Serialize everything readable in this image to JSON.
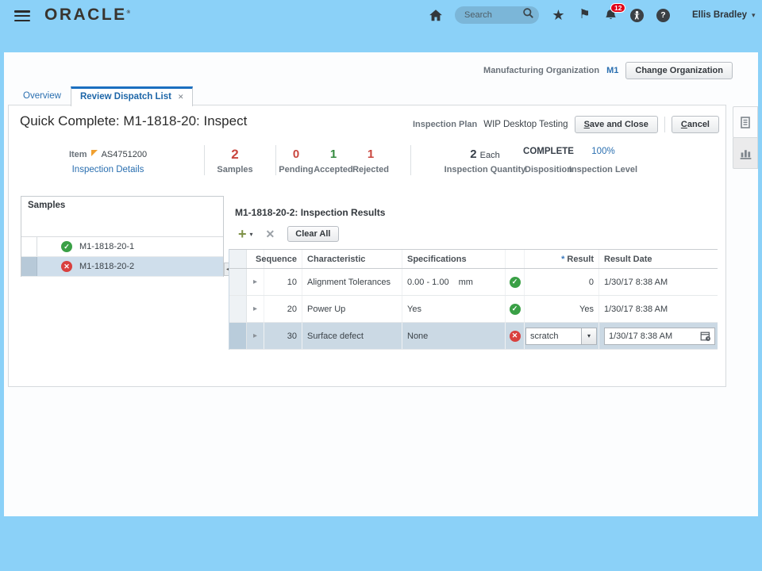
{
  "topbar": {
    "logo": "ORACLE",
    "search_placeholder": "Search",
    "notification_count": "12",
    "user_name": "Ellis Bradley"
  },
  "org": {
    "label": "Manufacturing Organization",
    "value": "M1",
    "change_button": "Change Organization"
  },
  "tabs": {
    "overview": "Overview",
    "active": "Review Dispatch List"
  },
  "header": {
    "title": "Quick Complete: M1-1818-20: Inspect",
    "plan_label": "Inspection Plan",
    "plan_value": "WIP Desktop Testing",
    "save_button": "Save and Close",
    "cancel_button": "Cancel"
  },
  "summary": {
    "item_label": "Item",
    "item_value": "AS4751200",
    "details_link": "Inspection Details",
    "samples_value": "2",
    "samples_label": "Samples",
    "pending_value": "0",
    "pending_label": "Pending",
    "accepted_value": "1",
    "accepted_label": "Accepted",
    "rejected_value": "1",
    "rejected_label": "Rejected",
    "qty_value": "2",
    "qty_unit": "Each",
    "qty_label": "Inspection Quantity",
    "disposition_value": "COMPLETE",
    "disposition_label": "Disposition",
    "level_value": "100%",
    "level_label": "Inspection Level"
  },
  "samples_panel": {
    "title": "Samples",
    "rows": [
      {
        "id": "M1-1818-20-1",
        "status": "accepted"
      },
      {
        "id": "M1-1818-20-2",
        "status": "rejected"
      }
    ]
  },
  "results": {
    "title": "M1-1818-20-2: Inspection Results",
    "clear_all": "Clear All",
    "headers": {
      "sequence": "Sequence",
      "characteristic": "Characteristic",
      "specifications": "Specifications",
      "result": "Result",
      "result_date": "Result Date"
    },
    "rows": [
      {
        "sequence": "10",
        "characteristic": "Alignment Tolerances",
        "spec": "0.00 - 1.00",
        "uom": "mm",
        "status": "accepted",
        "result": "0",
        "date": "1/30/17 8:38 AM"
      },
      {
        "sequence": "20",
        "characteristic": "Power Up",
        "spec": "Yes",
        "uom": "",
        "status": "accepted",
        "result": "Yes",
        "date": "1/30/17 8:38 AM"
      },
      {
        "sequence": "30",
        "characteristic": "Surface defect",
        "spec": "None",
        "uom": "",
        "status": "rejected",
        "result": "scratch",
        "date": "1/30/17 8:38 AM"
      }
    ]
  },
  "icons": {
    "check": "✓",
    "cross": "✕",
    "expand": "▸",
    "caret_down": "▾",
    "plus": "+",
    "star": "★",
    "flag": "⚑",
    "collapse": "◂",
    "help": "?",
    "close": "✕",
    "required": "*",
    "registered": "®"
  },
  "colors": {
    "topbar_blue": "#8BD1F8",
    "tab_accent": "#1B6FC0",
    "link_blue": "#2A6FB0",
    "status_red": "#C9463E",
    "status_green": "#338A3E",
    "icon_green": "#3AA046",
    "icon_red": "#D9403E",
    "selected_row": "#CBD9E4"
  }
}
